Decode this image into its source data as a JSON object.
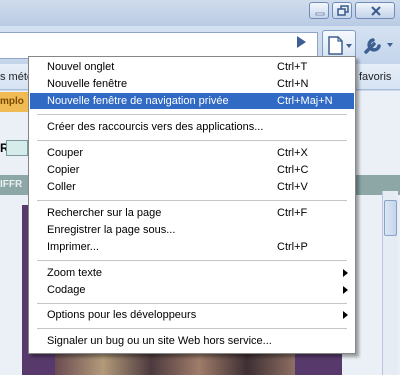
{
  "browser": {
    "bookmarks_left": "s méto",
    "bookmarks_right": "favoris",
    "page_fragment_1": "mplo",
    "page_fragment_2": "R",
    "page_fragment_3": "IFFR"
  },
  "menu": {
    "items": [
      {
        "label": "Nouvel onglet",
        "shortcut": "Ctrl+T"
      },
      {
        "label": "Nouvelle fenêtre",
        "shortcut": "Ctrl+N"
      },
      {
        "label": "Nouvelle fenêtre de navigation privée",
        "shortcut": "Ctrl+Maj+N"
      },
      {
        "label": "Créer des raccourcis vers des applications...",
        "shortcut": ""
      },
      {
        "label": "Couper",
        "shortcut": "Ctrl+X"
      },
      {
        "label": "Copier",
        "shortcut": "Ctrl+C"
      },
      {
        "label": "Coller",
        "shortcut": "Ctrl+V"
      },
      {
        "label": "Rechercher sur la page",
        "shortcut": "Ctrl+F"
      },
      {
        "label": "Enregistrer la page sous...",
        "shortcut": ""
      },
      {
        "label": "Imprimer...",
        "shortcut": "Ctrl+P"
      },
      {
        "label": "Zoom texte",
        "shortcut": ""
      },
      {
        "label": "Codage",
        "shortcut": ""
      },
      {
        "label": "Options pour les développeurs",
        "shortcut": ""
      },
      {
        "label": "Signaler un bug ou un site Web hors service...",
        "shortcut": ""
      }
    ]
  },
  "colors": {
    "highlight": "#316ac5",
    "menu_border": "#868686"
  }
}
